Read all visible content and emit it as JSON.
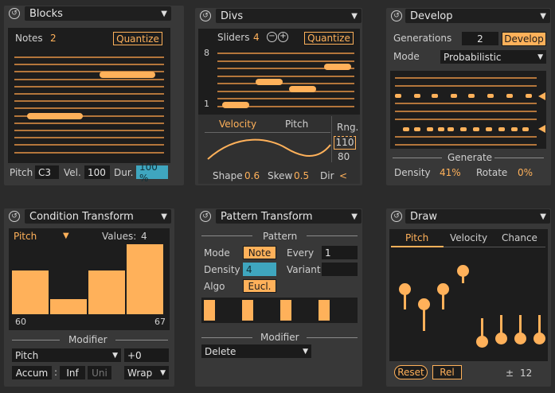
{
  "blocks": {
    "title": "Blocks",
    "notes_label": "Notes",
    "notes_value": "2",
    "quantize": "Quantize",
    "pitch_label": "Pitch",
    "pitch_value": "C3",
    "vel_label": "Vel.",
    "vel_value": "100",
    "dur_label": "Dur.",
    "dur_value": "100 %"
  },
  "divs": {
    "title": "Divs",
    "sliders_label": "Sliders",
    "sliders_value": "4",
    "minus": "−",
    "plus": "+",
    "quantize": "Quantize",
    "max_label": "8",
    "min_label": "1",
    "tab_velocity": "Velocity",
    "tab_pitch": "Pitch",
    "rng_label": "Rng.",
    "rng_high": "110",
    "rng_low": "80",
    "shape_label": "Shape",
    "shape_value": "0.6",
    "skew_label": "Skew",
    "skew_value": "0.5",
    "dir_label": "Dir",
    "dir_value": "<"
  },
  "develop": {
    "title": "Develop",
    "generations_label": "Generations",
    "generations_value": "2",
    "develop_button": "Develop",
    "mode_label": "Mode",
    "mode_value": "Probabilistic",
    "generate_label": "Generate",
    "density_label": "Density",
    "density_value": "41%",
    "rotate_label": "Rotate",
    "rotate_value": "0%"
  },
  "condition": {
    "title": "Condition Transform",
    "param": "Pitch",
    "values_label": "Values:",
    "values_count": "4",
    "bars": [
      0.62,
      0.22,
      0.62,
      1.0
    ],
    "range_low": "60",
    "range_high": "67",
    "modifier_label": "Modifier",
    "mod_target": "Pitch",
    "mod_amount": "+0",
    "accum": "Accum",
    "colon": ":",
    "inf": "Inf",
    "uni": "Uni",
    "wrap": "Wrap"
  },
  "pattern": {
    "title": "Pattern Transform",
    "section_label": "Pattern",
    "mode_label": "Mode",
    "mode_value": "Note",
    "every_label": "Every",
    "every_value": "1",
    "density_label": "Density",
    "density_value": "4",
    "variant_label": "Variant",
    "variant_value": "",
    "algo_label": "Algo",
    "algo_value": "Eucl.",
    "modifier_label": "Modifier",
    "modifier_value": "Delete"
  },
  "draw": {
    "title": "Draw",
    "tab_pitch": "Pitch",
    "tab_velocity": "Velocity",
    "tab_chance": "Chance",
    "reset": "Reset",
    "rel": "Rel",
    "pm": "±",
    "pm_value": "12",
    "sliders": [
      0.55,
      0.35,
      0.55,
      0.8,
      0.15,
      0.2,
      0.2,
      0.2
    ]
  },
  "colors": {
    "accent": "#ffb15a",
    "bg": "#2b2b2b",
    "device": "#383838",
    "panel": "#1d1d1d"
  }
}
